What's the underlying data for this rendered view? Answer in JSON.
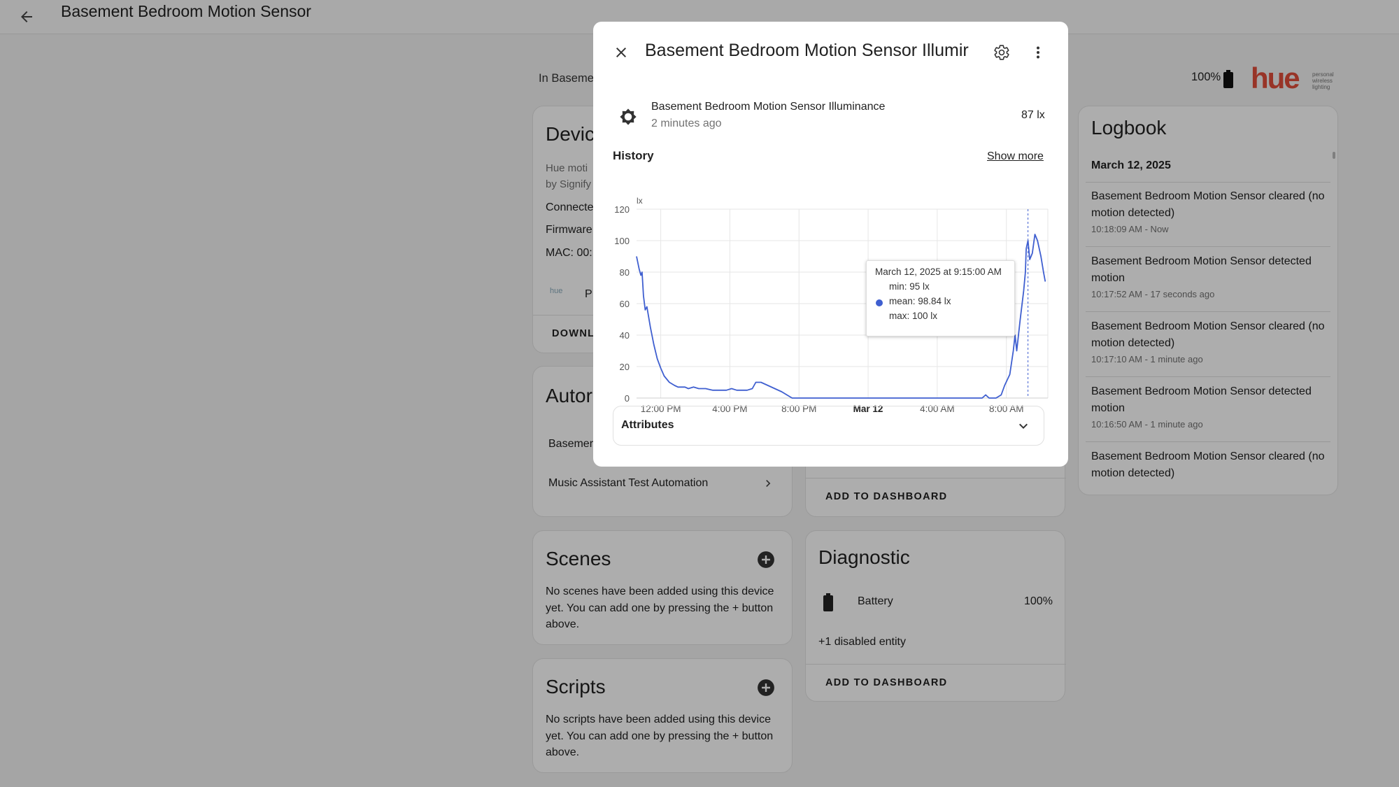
{
  "page": {
    "title": "Basement Bedroom Motion Sensor",
    "area_text": "In Baseme"
  },
  "header_right": {
    "battery": "100%",
    "brand_logo_text": "hue",
    "brand_tagline": [
      "personal",
      "wireless",
      "lighting"
    ]
  },
  "device_card": {
    "title": "Devic",
    "model": "Hue moti",
    "by": "by Signify",
    "connected": "Connecte",
    "firmware": "Firmware",
    "mac": "MAC: 00:",
    "integration_logo": "hue",
    "integration_label": "P",
    "download_label": "DOWNL"
  },
  "automations_card": {
    "title": "Autor",
    "item1": "Basemer",
    "item2": "Music Assistant Test Automation"
  },
  "sensors_card": {
    "add_to_dashboard": "ADD TO DASHBOARD"
  },
  "scenes_card": {
    "title": "Scenes",
    "empty_text": "No scenes have been added using this device yet. You can add one by pressing the + button above."
  },
  "scripts_card": {
    "title": "Scripts",
    "empty_text": "No scripts have been added using this device yet. You can add one by pressing the + button above."
  },
  "diagnostic_card": {
    "title": "Diagnostic",
    "battery_label": "Battery",
    "battery_value": "100%",
    "disabled_entities": "+1 disabled entity",
    "add_to_dashboard": "ADD TO DASHBOARD"
  },
  "logbook": {
    "title": "Logbook",
    "date": "March 12, 2025",
    "entries": [
      {
        "message": "Basement Bedroom Motion Sensor cleared (no motion detected)",
        "time": "10:18:09 AM - Now"
      },
      {
        "message": "Basement Bedroom Motion Sensor detected motion",
        "time": "10:17:52 AM - 17 seconds ago"
      },
      {
        "message": "Basement Bedroom Motion Sensor cleared (no motion detected)",
        "time": "10:17:10 AM - 1 minute ago"
      },
      {
        "message": "Basement Bedroom Motion Sensor detected motion",
        "time": "10:16:50 AM - 1 minute ago"
      },
      {
        "message": "Basement Bedroom Motion Sensor cleared (no motion detected)",
        "time": ""
      }
    ]
  },
  "dialog": {
    "title": "Basement Bedroom Motion Sensor Illumir",
    "entity_name": "Basement Bedroom Motion Sensor Illuminance",
    "last_changed": "2 minutes ago",
    "state": "87 lx",
    "history_label": "History",
    "show_more": "Show more",
    "attributes_label": "Attributes"
  },
  "chart_data": {
    "type": "line",
    "title": "",
    "xlabel": "",
    "ylabel": "lx",
    "ylim": [
      0,
      120
    ],
    "yticks": [
      0,
      20,
      40,
      60,
      80,
      100,
      120
    ],
    "xlim": [
      10.6,
      34.4
    ],
    "xticks": [
      {
        "label": "12:00 PM",
        "x": 12,
        "bold": false
      },
      {
        "label": "4:00 PM",
        "x": 16,
        "bold": false
      },
      {
        "label": "8:00 PM",
        "x": 20,
        "bold": false
      },
      {
        "label": "Mar 12",
        "x": 24,
        "bold": true
      },
      {
        "label": "4:00 AM",
        "x": 28,
        "bold": false
      },
      {
        "label": "8:00 AM",
        "x": 32,
        "bold": false
      }
    ],
    "grid": true,
    "series": [
      {
        "color": "#3f5fd0",
        "points": [
          [
            10.6,
            90
          ],
          [
            10.75,
            82
          ],
          [
            10.85,
            78
          ],
          [
            10.92,
            80
          ],
          [
            11.0,
            65
          ],
          [
            11.1,
            56
          ],
          [
            11.2,
            58
          ],
          [
            11.4,
            45
          ],
          [
            11.6,
            34
          ],
          [
            11.8,
            25
          ],
          [
            12.0,
            19
          ],
          [
            12.2,
            14
          ],
          [
            12.5,
            10
          ],
          [
            12.8,
            8
          ],
          [
            13.0,
            7
          ],
          [
            13.4,
            7
          ],
          [
            13.6,
            6
          ],
          [
            13.9,
            7
          ],
          [
            14.2,
            6
          ],
          [
            14.6,
            6
          ],
          [
            15.0,
            5
          ],
          [
            15.4,
            5
          ],
          [
            15.8,
            5
          ],
          [
            16.1,
            6
          ],
          [
            16.4,
            5
          ],
          [
            16.7,
            5
          ],
          [
            17.0,
            5
          ],
          [
            17.3,
            6
          ],
          [
            17.5,
            10
          ],
          [
            17.8,
            10
          ],
          [
            18.2,
            8
          ],
          [
            18.6,
            6
          ],
          [
            19.0,
            4
          ],
          [
            19.3,
            2
          ],
          [
            19.6,
            0
          ],
          [
            20,
            0
          ],
          [
            22,
            0
          ],
          [
            24,
            0
          ],
          [
            26,
            0
          ],
          [
            28,
            0
          ],
          [
            30,
            0
          ],
          [
            30.6,
            0
          ],
          [
            30.8,
            2
          ],
          [
            31.0,
            0
          ],
          [
            31.4,
            0
          ],
          [
            31.7,
            2
          ],
          [
            31.9,
            8
          ],
          [
            32.2,
            15
          ],
          [
            32.4,
            30
          ],
          [
            32.5,
            40
          ],
          [
            32.6,
            30
          ],
          [
            32.8,
            50
          ],
          [
            33.0,
            68
          ],
          [
            33.1,
            80
          ],
          [
            33.15,
            95
          ],
          [
            33.25,
            100
          ],
          [
            33.35,
            88
          ],
          [
            33.5,
            92
          ],
          [
            33.65,
            104
          ],
          [
            33.8,
            100
          ],
          [
            34.0,
            90
          ],
          [
            34.15,
            80
          ],
          [
            34.25,
            74
          ]
        ]
      }
    ],
    "cursor_x": 33.25,
    "tooltip": {
      "title": "March 12, 2025 at 9:15:00 AM",
      "min": "min: 95 lx",
      "mean": "mean: 98.84 lx",
      "max": "max: 100 lx"
    }
  },
  "colors": {
    "accent": "#3f5fd0",
    "overlay": "rgba(0,0,0,0.32)"
  }
}
